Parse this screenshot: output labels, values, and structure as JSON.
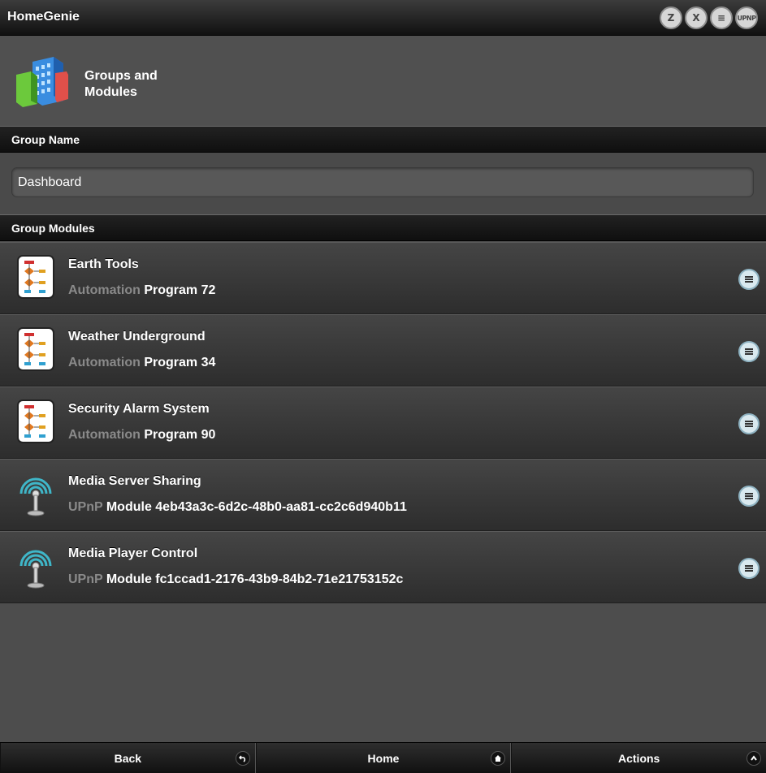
{
  "app": {
    "title": "HomeGenie"
  },
  "status_icons": [
    {
      "name": "zwave-icon",
      "glyph": "Z"
    },
    {
      "name": "x10-icon",
      "glyph": "X"
    },
    {
      "name": "insteon-icon",
      "glyph": "≡"
    },
    {
      "name": "upnp-icon",
      "glyph": "UPNP"
    }
  ],
  "page": {
    "title": "Groups and Modules"
  },
  "group_name": {
    "header": "Group Name",
    "value": "Dashboard"
  },
  "group_modules": {
    "header": "Group Modules",
    "items": [
      {
        "name": "Earth Tools",
        "domain": "Automation",
        "address": "Program 72",
        "icon": "program-flowchart-icon"
      },
      {
        "name": "Weather Underground",
        "domain": "Automation",
        "address": "Program 34",
        "icon": "program-flowchart-icon"
      },
      {
        "name": "Security Alarm System",
        "domain": "Automation",
        "address": "Program 90",
        "icon": "program-flowchart-icon"
      },
      {
        "name": "Media Server Sharing",
        "domain": "UPnP",
        "address": "Module 4eb43a3c-6d2c-48b0-aa81-cc2c6d940b11",
        "icon": "upnp-antenna-icon"
      },
      {
        "name": "Media Player Control",
        "domain": "UPnP",
        "address": "Module fc1ccad1-2176-43b9-84b2-71e21753152c",
        "icon": "upnp-antenna-icon"
      }
    ]
  },
  "footer": {
    "back": "Back",
    "home": "Home",
    "actions": "Actions"
  },
  "colors": {
    "accent_button": "#d9e9ef",
    "domain_text": "#8a8a8a"
  }
}
